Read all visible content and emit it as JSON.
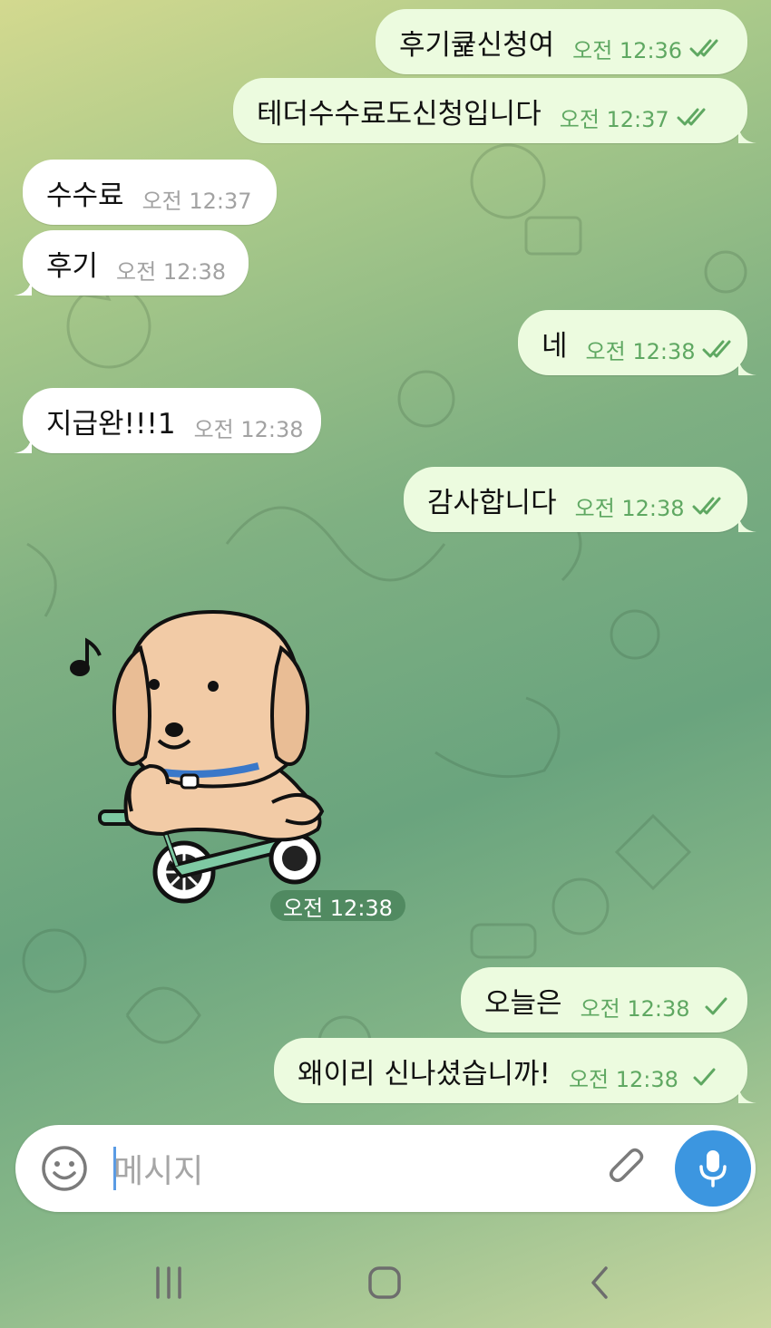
{
  "messages": [
    {
      "text": "후기큝신청여",
      "time": "오전 12:36",
      "dir": "out",
      "status": "read"
    },
    {
      "text": "테더수수료도신청입니다",
      "time": "오전 12:37",
      "dir": "out",
      "status": "read"
    },
    {
      "text": "수수료",
      "time": "오전 12:37",
      "dir": "in"
    },
    {
      "text": "후기",
      "time": "오전 12:38",
      "dir": "in"
    },
    {
      "text": "네",
      "time": "오전 12:38",
      "dir": "out",
      "status": "read"
    },
    {
      "text": "지급완!!!1",
      "time": "오전 12:38",
      "dir": "in"
    },
    {
      "text": "감사합니다",
      "time": "오전 12:38",
      "dir": "out",
      "status": "read"
    },
    {
      "text": "오늘은",
      "time": "오전 12:38",
      "dir": "out",
      "status": "sent"
    },
    {
      "text": "왜이리 신나셨습니까!",
      "time": "오전 12:38",
      "dir": "out",
      "status": "sent"
    }
  ],
  "sticker": {
    "time": "오전 12:38",
    "description_icon": "puppy-on-scooter-sticker"
  },
  "composer": {
    "placeholder": "메시지"
  },
  "colors": {
    "out_bubble": "#ecfbdf",
    "in_bubble": "#ffffff",
    "time_out": "#5fa862",
    "mic": "#3c96e0"
  }
}
